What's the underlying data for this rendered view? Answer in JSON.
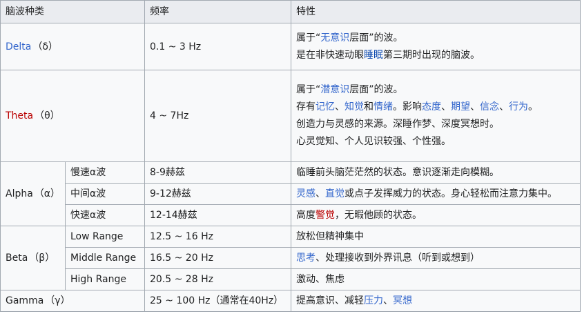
{
  "header": {
    "col_type": "脑波种类",
    "col_freq": "频率",
    "col_trait": "特性"
  },
  "delta": {
    "name": "Delta",
    "greek": "（δ）",
    "freq": "0.1 ~ 3 Hz",
    "line1": {
      "a": "属于“",
      "link": "无意识",
      "b": "层面”的波。"
    },
    "line2": {
      "a": "是在非快速动眼",
      "link": "睡眠",
      "b": "第三期时出现的脑波。"
    }
  },
  "theta": {
    "name": "Theta",
    "greek": "（θ）",
    "freq": "4 ~ 7Hz",
    "line1": {
      "a": "属于“",
      "link": "潜意识",
      "b": "层面”的波。"
    },
    "line2": {
      "a": "存有",
      "l1": "记忆",
      "s1": "、",
      "l2": "知觉",
      "s2": "和",
      "l3": "情绪",
      "s3": "。影响",
      "l4": "态度",
      "s4": "、",
      "l5": "期望",
      "s5": "、",
      "l6": "信念",
      "s6": "、",
      "l7": "行为",
      "s7": "。"
    },
    "line3": "创造力与灵感的来源。深睡作梦、深度冥想时。",
    "line4": "心灵觉知、个人见识较强、个性强。"
  },
  "alpha": {
    "name": "Alpha",
    "greek": "（α）",
    "rows": [
      {
        "sub": "慢速α波",
        "freq": "8-9赫兹",
        "trait": "临睡前头脑茫茫然的状态。意识逐渐走向模糊。"
      },
      {
        "sub": "中间α波",
        "freq": "9-12赫兹",
        "l1": "灵感",
        "s1": "、",
        "l2": "直觉",
        "rest": "或点子发挥威力的状态。身心轻松而注意力集中。"
      },
      {
        "sub": "快速α波",
        "freq": "12-14赫兹",
        "a": "高度",
        "link": "警觉",
        "b": "，无暇他顾的状态。"
      }
    ]
  },
  "beta": {
    "name": "Beta",
    "greek": "（β）",
    "rows": [
      {
        "sub": "Low Range",
        "freq": "12.5 ~ 16 Hz",
        "trait": "放松但精神集中"
      },
      {
        "sub": "Middle Range",
        "freq": "16.5 ~ 20 Hz",
        "link": "思考",
        "rest": "、处理接收到外界讯息（听到或想到）"
      },
      {
        "sub": "High Range",
        "freq": "20.5 ~ 28 Hz",
        "trait": "激动、焦虑"
      }
    ]
  },
  "gamma": {
    "name": "Gamma",
    "greek": "（γ）",
    "freq": "25 ~ 100 Hz（通常在40Hz）",
    "a": "提高意识、减轻",
    "l1": "压力",
    "s1": "、",
    "l2": "冥想"
  },
  "colors": {
    "link": "#3366cc",
    "red_link": "#ba0000",
    "header_bg": "#eaecf0",
    "cell_bg": "#f8f9fa",
    "border": "#a2a9b1"
  }
}
